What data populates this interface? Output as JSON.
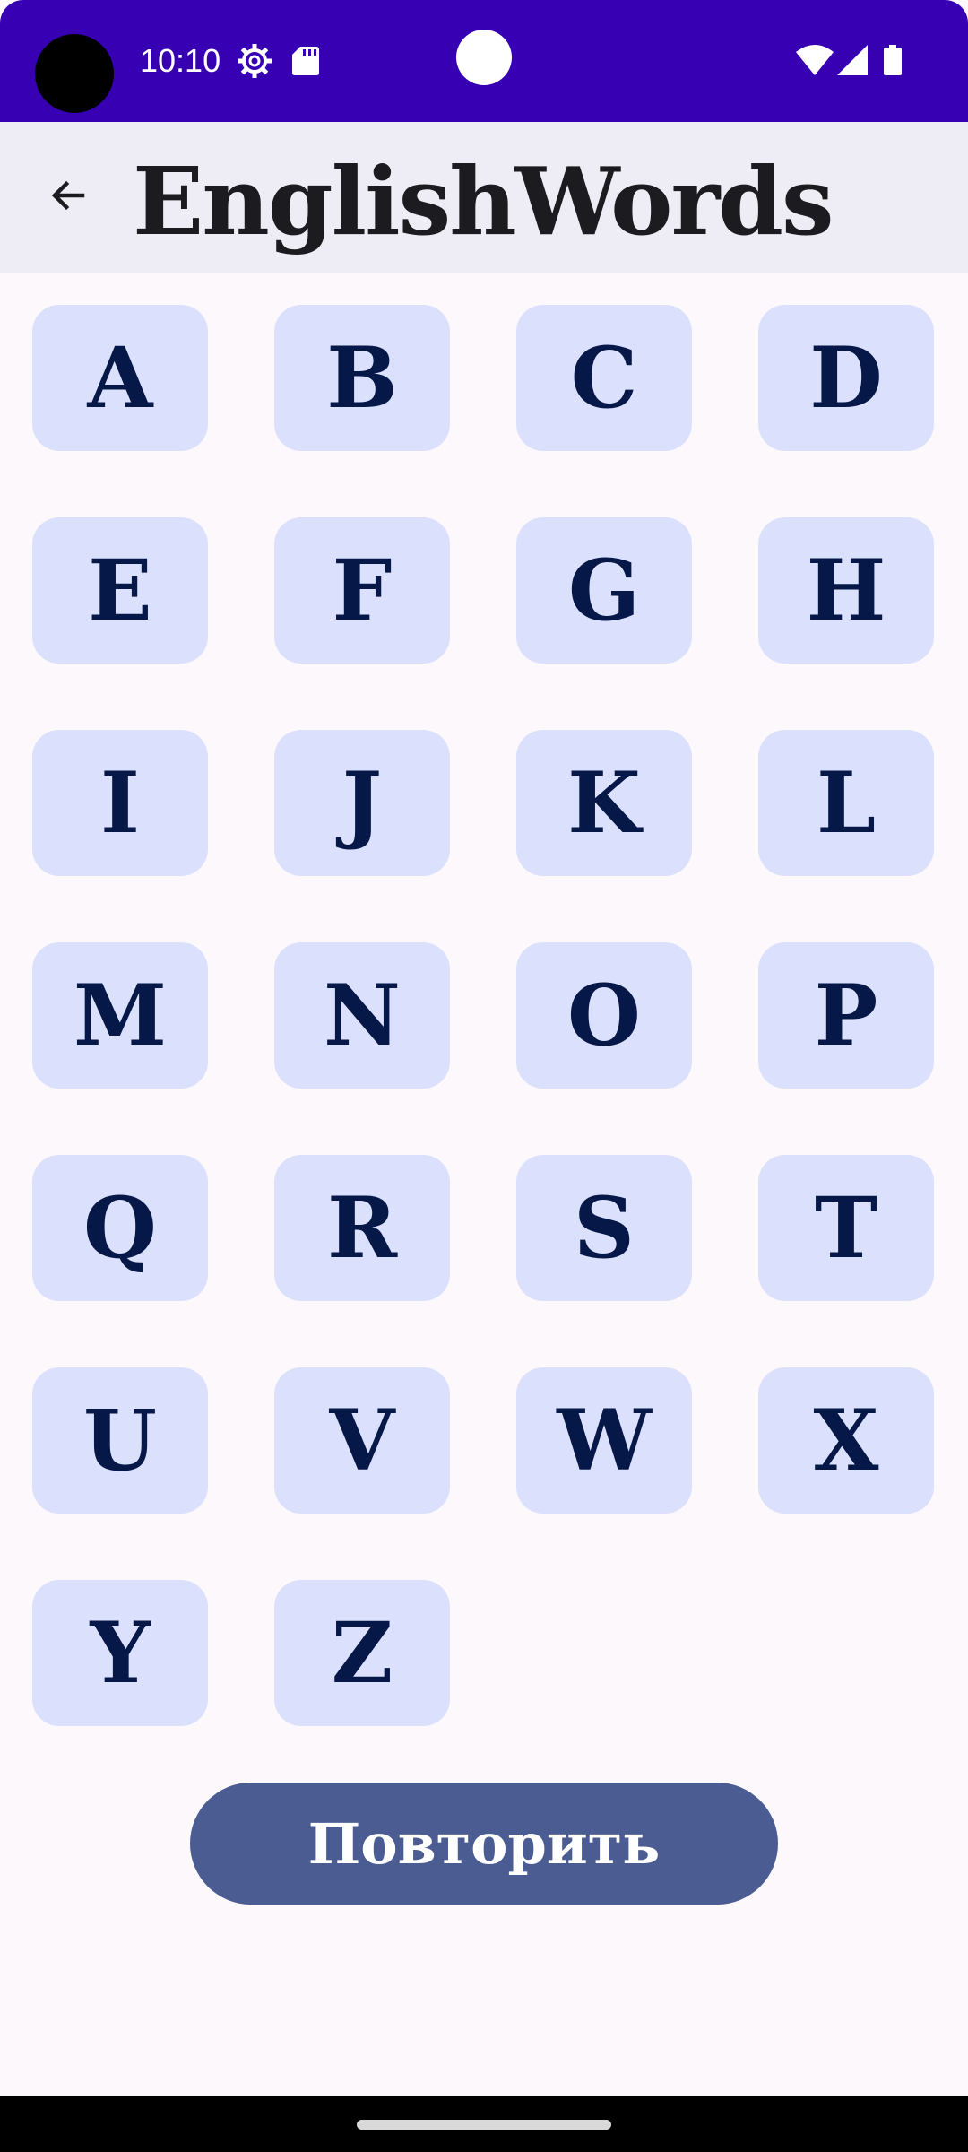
{
  "status_bar": {
    "time": "10:10",
    "icons": [
      "settings-gear-icon",
      "sd-card-icon",
      "wifi-icon",
      "cellular-signal-icon",
      "battery-icon"
    ],
    "background_color": "#3700b3"
  },
  "app_bar": {
    "title": "EnglishWords",
    "back_icon": "arrow-back-icon",
    "background_color": "#eeedf6"
  },
  "letters": [
    "A",
    "B",
    "C",
    "D",
    "E",
    "F",
    "G",
    "H",
    "I",
    "J",
    "K",
    "L",
    "M",
    "N",
    "O",
    "P",
    "Q",
    "R",
    "S",
    "T",
    "U",
    "V",
    "W",
    "X",
    "Y",
    "Z"
  ],
  "letter_style": {
    "button_color": "#dbe1fc",
    "text_color": "#061848"
  },
  "repeat_button": {
    "label": "Повторить",
    "color": "#4a5c92"
  }
}
